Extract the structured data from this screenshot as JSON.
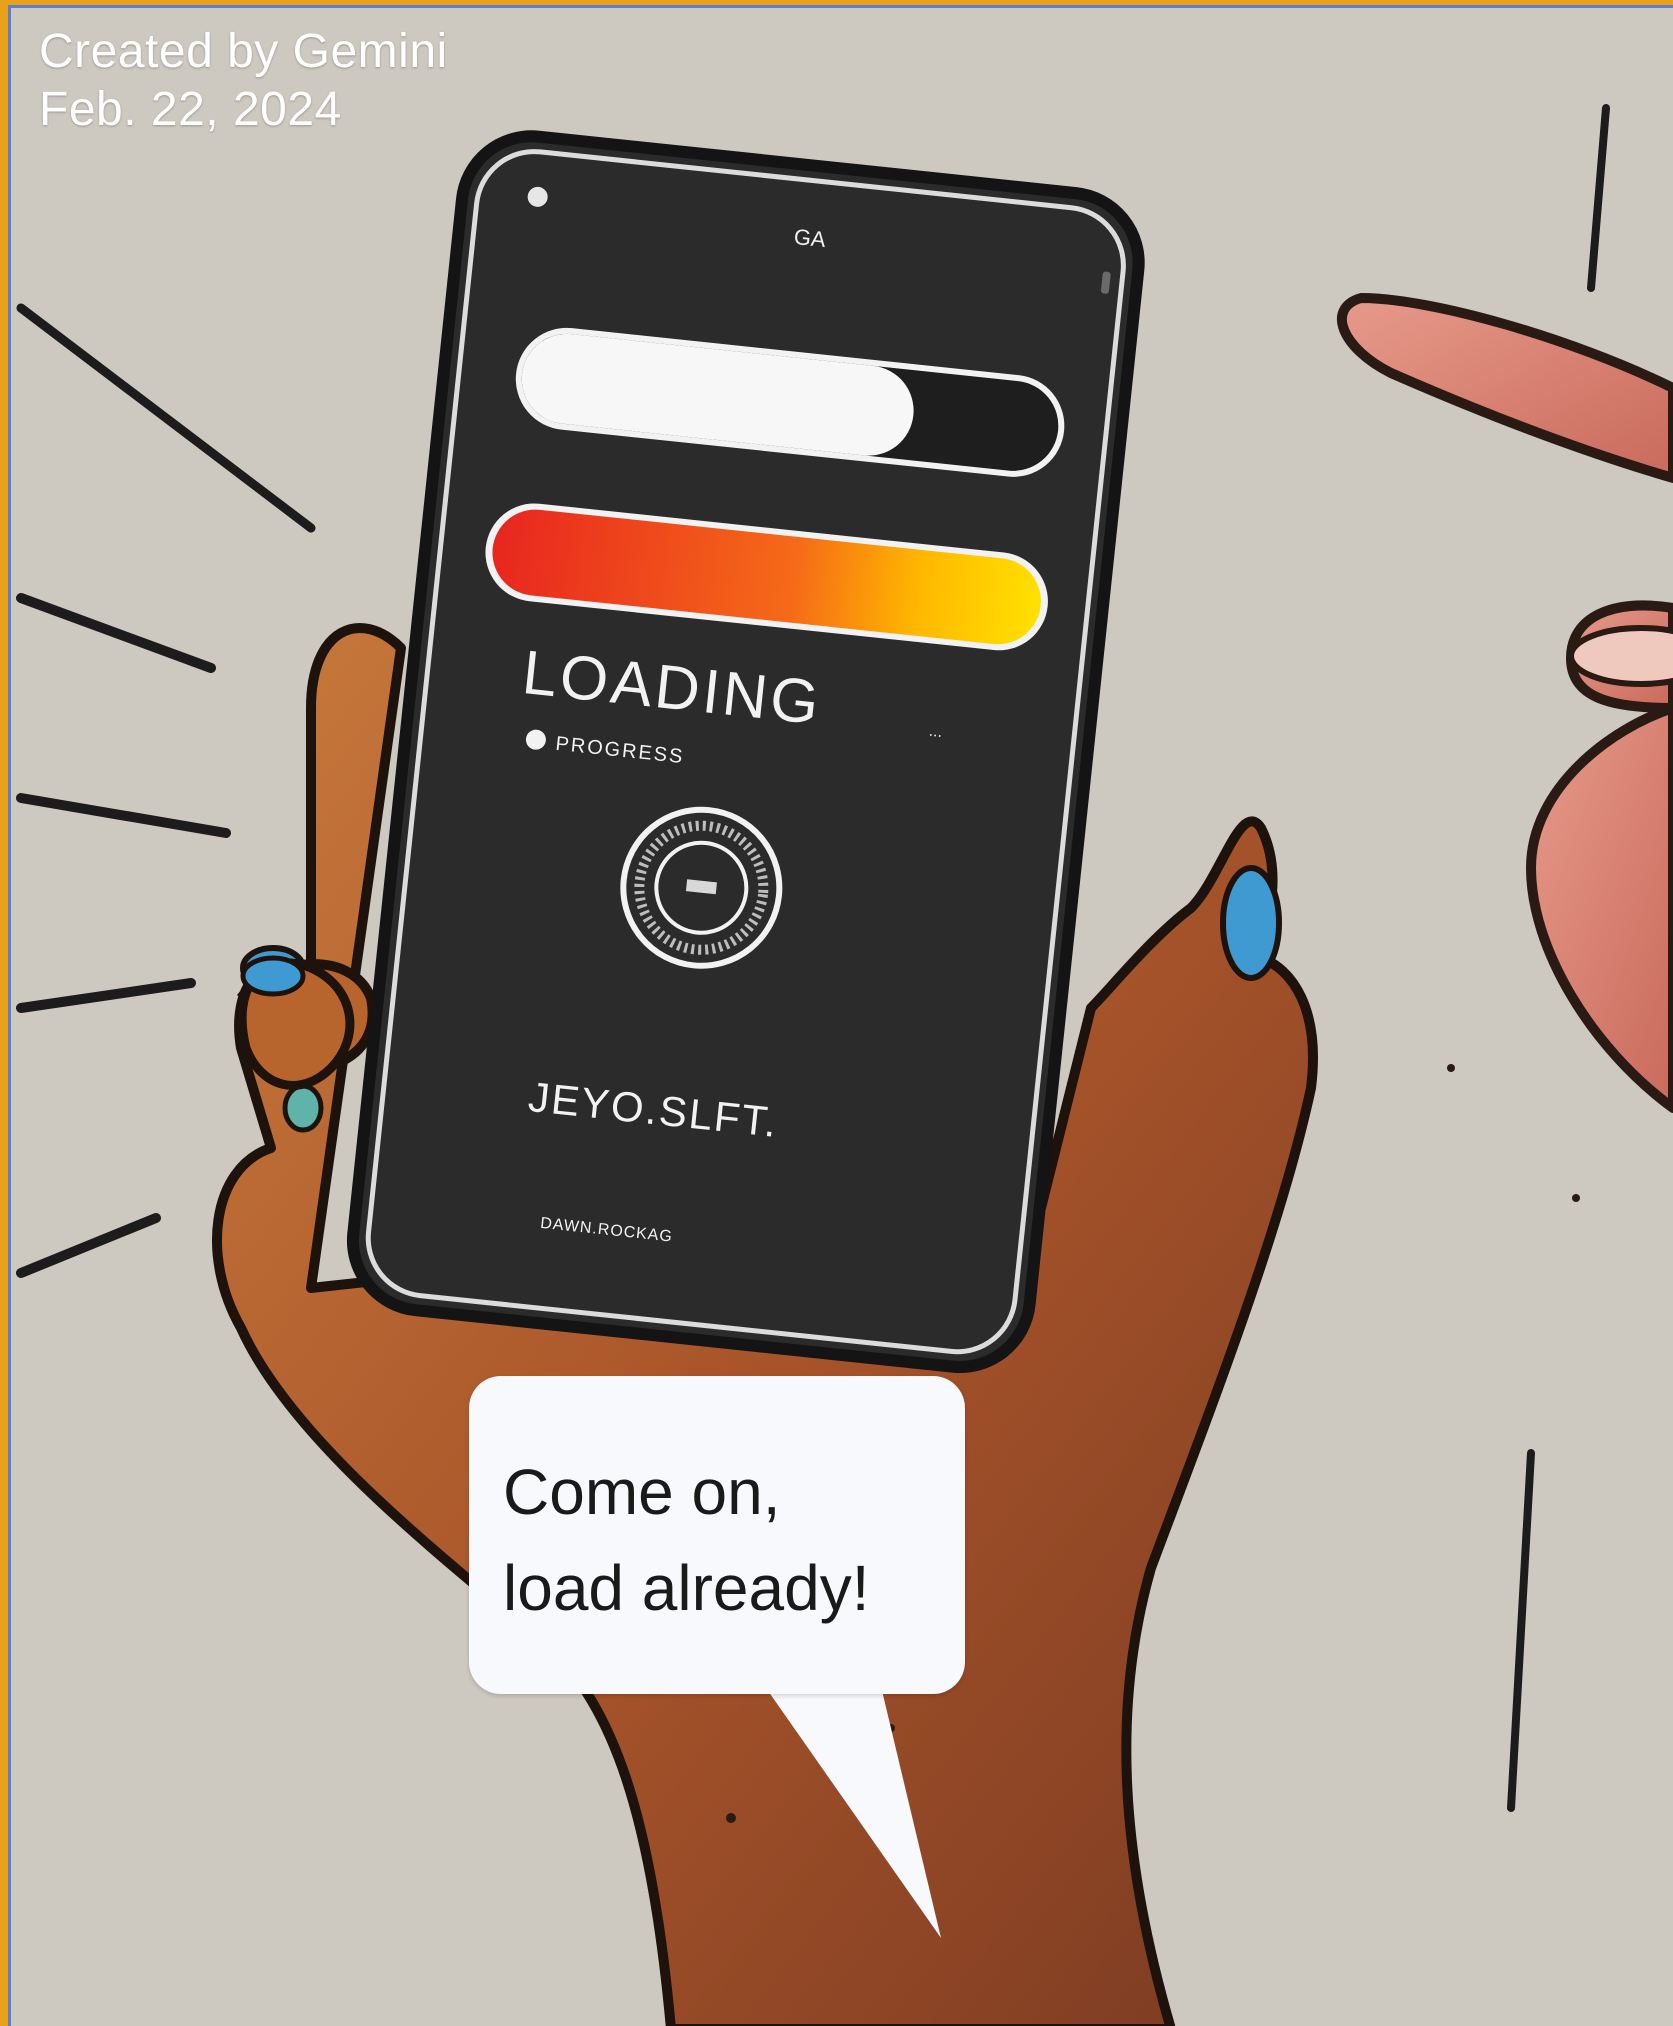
{
  "credit": {
    "line1": "Created by Gemini",
    "line2": "Feb. 22, 2024"
  },
  "phone_screen": {
    "top_label": "GA",
    "loading_text": "LOADING",
    "loading_suffix": "...",
    "sub_text": "PROGRESS",
    "footer_text": "JEYO.SLFT.",
    "bottom_text": "DAWN.ROCKAG"
  },
  "progress_bars": {
    "white_bar_fraction": 0.73,
    "gradient_bar_fraction": 1.0,
    "gradient_colors": [
      "#e8261f",
      "#f56a18",
      "#ffe100"
    ]
  },
  "speech_bubble": {
    "line1": "Come on,",
    "line2": "load already!"
  },
  "colors": {
    "border": "#e8a21a",
    "background": "#cdc8c0",
    "phone_body": "#2b2b2b",
    "nail_polish": "#3f9ad1",
    "skin": "#b8652d"
  }
}
